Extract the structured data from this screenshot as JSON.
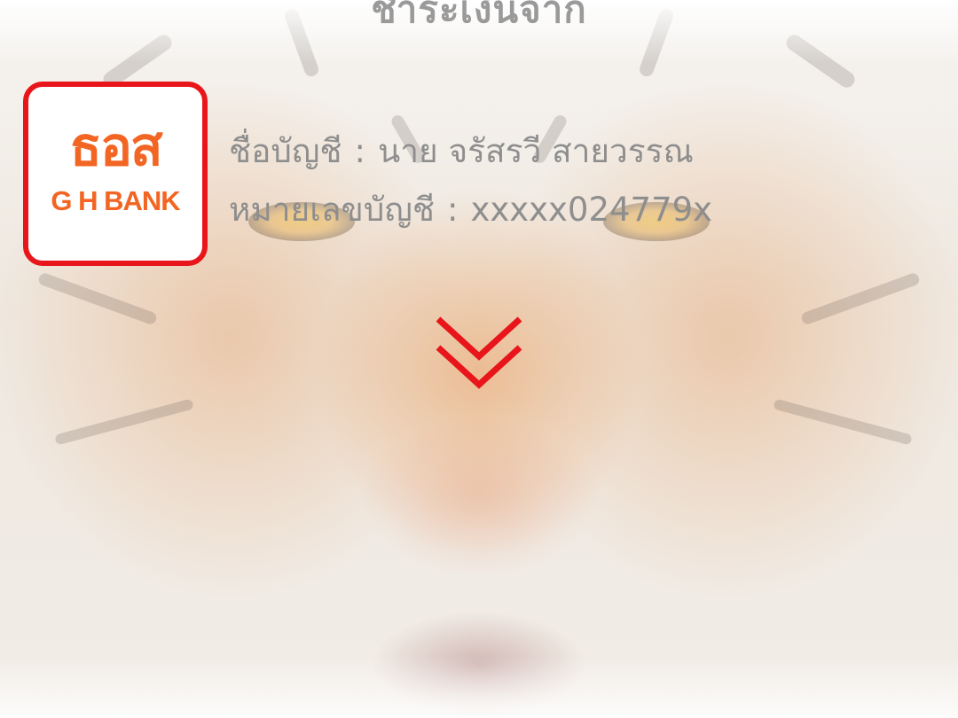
{
  "header": {
    "title": "ชำระเงินจาก"
  },
  "bank": {
    "logo_thai": "ธอส",
    "logo_english": "G H BANK",
    "border_color": "#e8151b",
    "text_color": "#f26522"
  },
  "account": {
    "name_label": "ชื่อบัญชี",
    "name_value": "นาย จรัสรวี สายวรรณ",
    "number_label": "หมายเลขบัญชี",
    "number_value": "xxxxx024779x",
    "separator": ":"
  },
  "indicator": {
    "icon": "double-chevron-down-icon",
    "color": "#e8151b"
  }
}
